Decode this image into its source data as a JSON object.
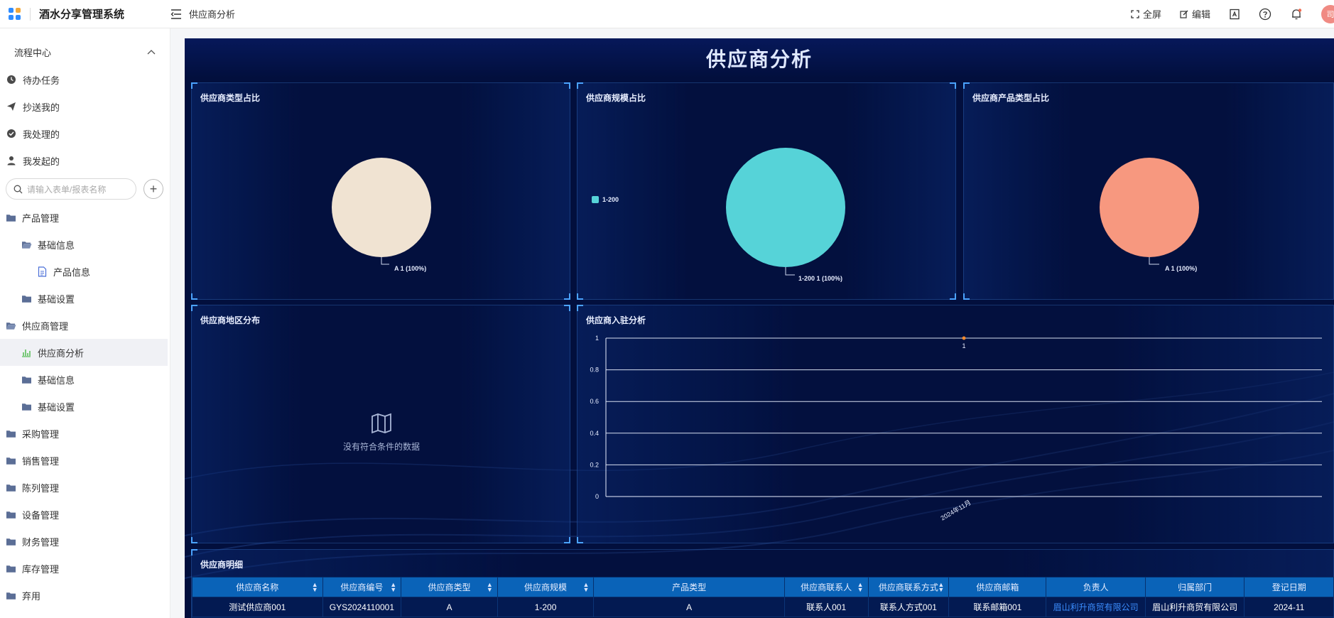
{
  "app": {
    "title": "酒水分享管理系统"
  },
  "header": {
    "breadcrumb": "供应商分析",
    "fullscreen_label": "全屏",
    "edit_label": "编辑",
    "avatar_text": "司"
  },
  "sidebar": {
    "section_label": "流程中心",
    "quick_items": [
      {
        "label": "待办任务",
        "icon": "clock-icon"
      },
      {
        "label": "抄送我的",
        "icon": "send-icon"
      },
      {
        "label": "我处理的",
        "icon": "check-circle-icon"
      },
      {
        "label": "我发起的",
        "icon": "user-icon"
      }
    ],
    "search_placeholder": "请输入表单/报表名称",
    "tree": [
      {
        "label": "产品管理",
        "level": 0,
        "icon": "folder-icon"
      },
      {
        "label": "基础信息",
        "level": 1,
        "icon": "folder-open-icon"
      },
      {
        "label": "产品信息",
        "level": 2,
        "icon": "document-icon"
      },
      {
        "label": "基础设置",
        "level": 1,
        "icon": "folder-icon"
      },
      {
        "label": "供应商管理",
        "level": 0,
        "icon": "folder-open-icon"
      },
      {
        "label": "供应商分析",
        "level": 1,
        "icon": "chart-icon",
        "active": true
      },
      {
        "label": "基础信息",
        "level": 1,
        "icon": "folder-icon"
      },
      {
        "label": "基础设置",
        "level": 1,
        "icon": "folder-icon"
      },
      {
        "label": "采购管理",
        "level": 0,
        "icon": "folder-icon"
      },
      {
        "label": "销售管理",
        "level": 0,
        "icon": "folder-icon"
      },
      {
        "label": "陈列管理",
        "level": 0,
        "icon": "folder-icon"
      },
      {
        "label": "设备管理",
        "level": 0,
        "icon": "folder-icon"
      },
      {
        "label": "财务管理",
        "level": 0,
        "icon": "folder-icon"
      },
      {
        "label": "库存管理",
        "level": 0,
        "icon": "folder-icon"
      },
      {
        "label": "弃用",
        "level": 0,
        "icon": "folder-icon"
      }
    ]
  },
  "dashboard": {
    "title": "供应商分析",
    "panels": {
      "type_ratio": "供应商类型占比",
      "scale_ratio": "供应商规模占比",
      "product_type_ratio": "供应商产品类型占比",
      "region": "供应商地区分布",
      "onboarding": "供应商入驻分析",
      "detail": "供应商明细"
    },
    "empty_text": "没有符合条件的数据",
    "colors": {
      "bg": "#020f3d",
      "pie1": "#f0e3d2",
      "pie2": "#56d3d8",
      "pie3": "#f7987f",
      "point": "#f28a2e",
      "header": "#0a63b8"
    }
  },
  "chart_data": [
    {
      "type": "pie",
      "title": "供应商类型占比",
      "slices": [
        {
          "name": "A",
          "value": 1,
          "percent": 100
        }
      ],
      "label": "A 1 (100%)"
    },
    {
      "type": "pie",
      "title": "供应商规模占比",
      "slices": [
        {
          "name": "1-200",
          "value": 1,
          "percent": 100
        }
      ],
      "legend": [
        "1-200"
      ],
      "label": "1-200 1 (100%)"
    },
    {
      "type": "pie",
      "title": "供应商产品类型占比",
      "slices": [
        {
          "name": "A",
          "value": 1,
          "percent": 100
        }
      ],
      "label": "A 1 (100%)"
    },
    {
      "type": "line",
      "title": "供应商入驻分析",
      "x": [
        "2024年11月"
      ],
      "series": [
        {
          "values": [
            1
          ]
        }
      ],
      "data_labels": [
        "1"
      ],
      "ylim": [
        0,
        1
      ],
      "yticks": [
        "0",
        "0.2",
        "0.4",
        "0.6",
        "0.8",
        "1"
      ],
      "grid": true
    }
  ],
  "table": {
    "columns": [
      "供应商名称",
      "供应商编号",
      "供应商类型",
      "供应商规模",
      "产品类型",
      "供应商联系人",
      "供应商联系方式",
      "供应商邮箱",
      "负责人",
      "归属部门",
      "登记日期"
    ],
    "rows": [
      [
        "测试供应商001",
        "GYS2024110001",
        "A",
        "1-200",
        "A",
        "联系人001",
        "联系人方式001",
        "联系邮箱001",
        "眉山利升商贸有限公司",
        "眉山利升商贸有限公司",
        "2024-11"
      ]
    ]
  }
}
